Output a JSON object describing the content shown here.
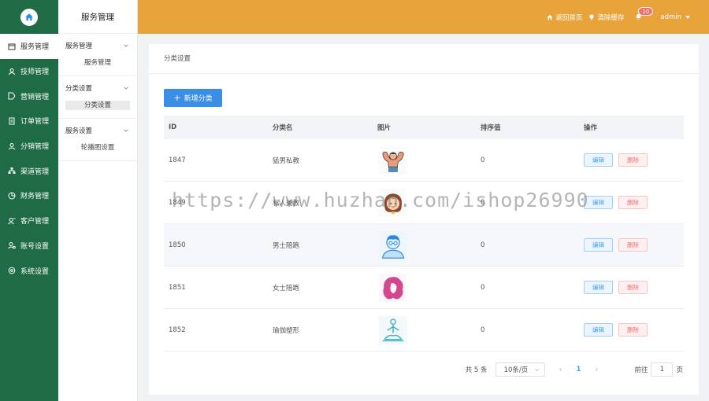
{
  "nav": {
    "items": [
      {
        "label": "服务管理",
        "icon": "calendar-icon",
        "active": true
      },
      {
        "label": "技师管理",
        "icon": "user-icon"
      },
      {
        "label": "营销管理",
        "icon": "tag-icon"
      },
      {
        "label": "订单管理",
        "icon": "document-icon"
      },
      {
        "label": "分销管理",
        "icon": "users-icon"
      },
      {
        "label": "渠道管理",
        "icon": "sitemap-icon"
      },
      {
        "label": "财务管理",
        "icon": "pie-chart-icon"
      },
      {
        "label": "客户管理",
        "icon": "customer-icon"
      },
      {
        "label": "账号设置",
        "icon": "account-icon"
      },
      {
        "label": "系统设置",
        "icon": "settings-icon"
      }
    ]
  },
  "subnav": {
    "title": "服务管理",
    "groups": [
      {
        "label": "服务管理",
        "items": [
          "服务管理"
        ]
      },
      {
        "label": "分类设置",
        "items": [
          "分类设置"
        ]
      },
      {
        "label": "服务设置",
        "items": [
          "轮播图设置"
        ]
      }
    ]
  },
  "header": {
    "home_label": "返回首页",
    "cache_label": "清除缓存",
    "notification_count": "10",
    "user": "admin"
  },
  "main": {
    "breadcrumb": "分类设置",
    "add_button": "新增分类",
    "columns": [
      "ID",
      "分类名",
      "图片",
      "排序值",
      "操作"
    ],
    "edit_label": "编辑",
    "delete_label": "删除",
    "rows": [
      {
        "id": "1847",
        "name": "猛男私教",
        "image": "muscle-man-icon",
        "sort": "0"
      },
      {
        "id": "1849",
        "name": "私人美教",
        "image": "woman-face-icon",
        "sort": "0"
      },
      {
        "id": "1850",
        "name": "男士陪跑",
        "image": "man-avatar-icon",
        "sort": "0"
      },
      {
        "id": "1851",
        "name": "女士陪跑",
        "image": "woman-hair-icon",
        "sort": "0"
      },
      {
        "id": "1852",
        "name": "瑜伽塑形",
        "image": "yoga-icon",
        "sort": "0"
      }
    ],
    "pagination": {
      "total": "共 5 条",
      "page_size": "10条/页",
      "current": "1",
      "goto_label": "前往",
      "goto_value": "1",
      "unit": "页"
    }
  },
  "watermark": "https://www.huzhan.com/ishop26990",
  "colors": {
    "sidebar": "#1e6b45",
    "header": "#e8a33b",
    "primary": "#3a8ee6",
    "danger": "#f56c6c"
  }
}
